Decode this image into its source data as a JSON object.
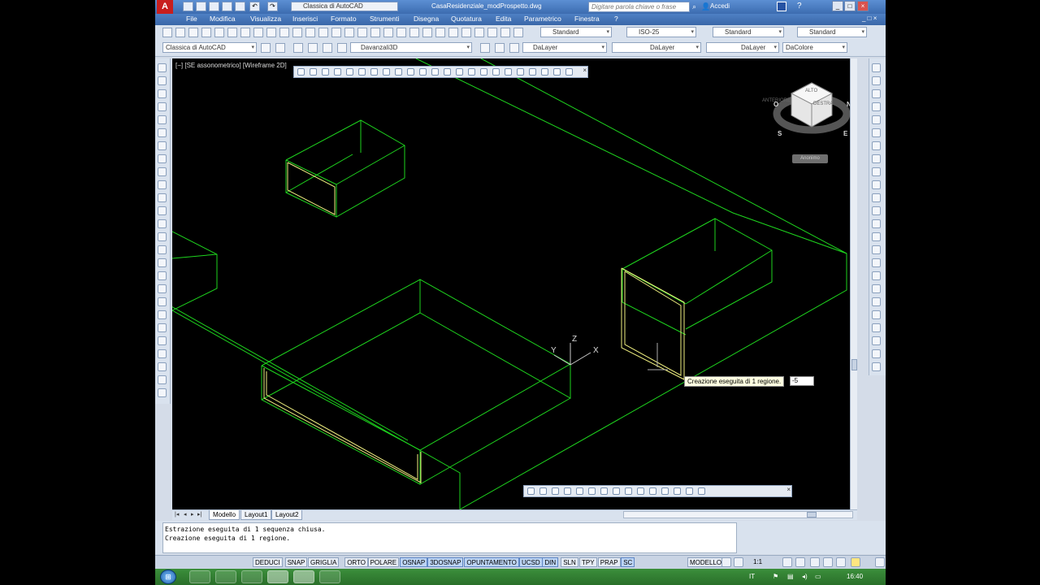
{
  "window": {
    "document_title": "CasaResidenziale_modProspetto.dwg",
    "workspace": "Classica di AutoCAD",
    "search_placeholder": "Digitare parola chiave o frase",
    "login_label": "Accedi",
    "controls": [
      "_",
      "□",
      "×"
    ]
  },
  "menu": [
    "File",
    "Modifica",
    "Visualizza",
    "Inserisci",
    "Formato",
    "Strumenti",
    "Disegna",
    "Quotatura",
    "Edita",
    "Parametrico",
    "Finestra",
    "?"
  ],
  "toolbar": {
    "text_style": "Standard",
    "dim_style": "ISO-25",
    "table_style": "Standard",
    "multileader_style": "Standard",
    "workspace2": "Classica di AutoCAD",
    "layer": "Davanzali3D",
    "layer_color": "DaLayer",
    "linetype": "DaLayer",
    "lineweight": "DaLayer",
    "plot_style": "DaColore"
  },
  "viewport": {
    "label": "[−] [SE assonometrico] [Wireframe 2D]",
    "tooltip": "Creazione eseguita di 1 regione.",
    "dynamic_input": "-5",
    "viewcube_button": "Anonimo",
    "viewcube_faces": [
      "ALTO",
      "ANTERIORE",
      "DESTRA"
    ],
    "compass": [
      "S",
      "E",
      "O",
      "N"
    ],
    "ucs_labels": [
      "X",
      "Y",
      "Z"
    ]
  },
  "tabs": [
    "Modello",
    "Layout1",
    "Layout2"
  ],
  "command_history": [
    "Estrazione eseguita di 1 sequenza chiusa.",
    "Creazione eseguita di 1 regione."
  ],
  "status": {
    "coordinates": "",
    "toggles": [
      {
        "label": "DEDUCI",
        "on": false
      },
      {
        "label": "SNAP",
        "on": false
      },
      {
        "label": "GRIGLIA",
        "on": false
      },
      {
        "label": "ORTO",
        "on": false
      },
      {
        "label": "POLARE",
        "on": false
      },
      {
        "label": "OSNAP",
        "on": true
      },
      {
        "label": "3DOSNAP",
        "on": true
      },
      {
        "label": "OPUNTAMENTO",
        "on": true
      },
      {
        "label": "UCSD",
        "on": true
      },
      {
        "label": "DIN",
        "on": true
      },
      {
        "label": "SLN",
        "on": false
      },
      {
        "label": "TPY",
        "on": false
      },
      {
        "label": "PRAP",
        "on": false
      },
      {
        "label": "SC",
        "on": true
      }
    ],
    "model_label": "MODELLO",
    "scale": "1:1"
  },
  "taskbar": {
    "language": "IT",
    "time": "16:40"
  },
  "colors": {
    "wire_green": "#1ed51e",
    "wire_yellow": "#f0f080",
    "title_blue": "#3c6cb0",
    "taskbar_green": "#2a6f2a"
  }
}
